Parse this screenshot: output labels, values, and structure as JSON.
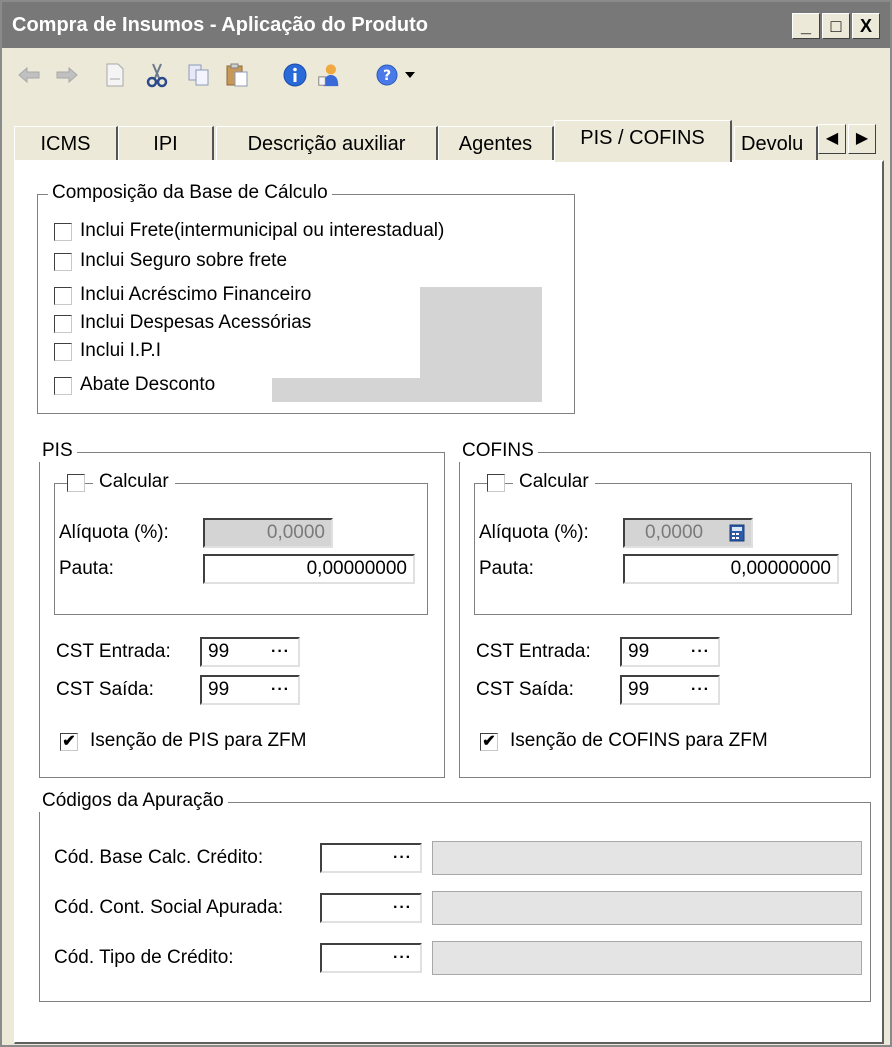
{
  "window": {
    "title": "Compra de Insumos - Aplicação do Produto",
    "controls": [
      "_",
      "□",
      "X"
    ]
  },
  "toolbar": {
    "icons": [
      "arrow-left-icon",
      "arrow-back-icon",
      "new-document-icon",
      "cut-icon",
      "copy-icon",
      "paste-icon",
      "info-icon",
      "user-icon",
      "help-icon",
      "dropdown-arrow-icon"
    ]
  },
  "tabs": [
    {
      "label": "ICMS"
    },
    {
      "label": "IPI"
    },
    {
      "label": "Descrição auxiliar"
    },
    {
      "label": "Agentes"
    },
    {
      "label": "PIS / COFINS"
    },
    {
      "label": "Devolu"
    }
  ],
  "composicao": {
    "legend": "Composição da Base de Cálculo",
    "items": [
      {
        "label": "Inclui Frete(intermunicipal ou interestadual)",
        "checked": false
      },
      {
        "label": "Inclui Seguro sobre frete",
        "checked": false
      },
      {
        "label": "Inclui Acréscimo Financeiro",
        "checked": false
      },
      {
        "label": "Inclui Despesas Acessórias",
        "checked": false
      },
      {
        "label": "Inclui I.P.I",
        "checked": false
      },
      {
        "label": "Abate Desconto",
        "checked": false
      }
    ]
  },
  "pis": {
    "legend": "PIS",
    "calcular_label": "Calcular",
    "aliquota_label": "Alíquota (%):",
    "aliquota_value": "0,0000",
    "pauta_label": "Pauta:",
    "pauta_value": "0,00000000",
    "cst_entrada_label": "CST Entrada:",
    "cst_entrada_value": "99",
    "cst_saida_label": "CST Saída:",
    "cst_saida_value": "99",
    "isencao_label": "Isenção de PIS para ZFM",
    "isencao_checked": true
  },
  "cofins": {
    "legend": "COFINS",
    "calcular_label": "Calcular",
    "aliquota_label": "Alíquota (%):",
    "aliquota_value": "0,0000",
    "pauta_label": "Pauta:",
    "pauta_value": "0,00000000",
    "cst_entrada_label": "CST Entrada:",
    "cst_entrada_value": "99",
    "cst_saida_label": "CST Saída:",
    "cst_saida_value": "99",
    "isencao_label": "Isenção de COFINS para ZFM",
    "isencao_checked": true
  },
  "apuracao": {
    "legend": "Códigos da Apuração",
    "base_calc_label": "Cód. Base Calc. Crédito:",
    "cont_social_label": "Cód. Cont. Social Apurada:",
    "tipo_credito_label": "Cód. Tipo de Crédito:"
  },
  "common": {
    "ellipsis": "···",
    "check": "✔"
  },
  "colors": {
    "titlebar": "#787878",
    "face": "#ece9d8",
    "disabled": "#d4d4d4"
  }
}
